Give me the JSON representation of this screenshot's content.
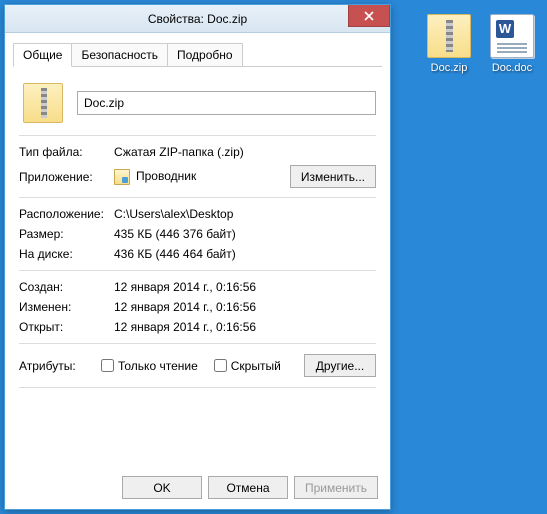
{
  "window": {
    "title": "Свойства: Doc.zip"
  },
  "tabs": {
    "general": "Общие",
    "security": "Безопасность",
    "details": "Подробно"
  },
  "file": {
    "name": "Doc.zip"
  },
  "labels": {
    "file_type": "Тип файла:",
    "application": "Приложение:",
    "location": "Расположение:",
    "size": "Размер:",
    "size_on_disk": "На диске:",
    "created": "Создан:",
    "modified": "Изменен:",
    "accessed": "Открыт:",
    "attributes": "Атрибуты:",
    "readonly": "Только чтение",
    "hidden": "Скрытый"
  },
  "values": {
    "file_type": "Сжатая ZIP-папка (.zip)",
    "application": "Проводник",
    "location": "C:\\Users\\alex\\Desktop",
    "size": "435 КБ (446 376 байт)",
    "size_on_disk": "436 КБ (446 464 байт)",
    "created": "12 января 2014 г., 0:16:56",
    "modified": "12 января 2014 г., 0:16:56",
    "accessed": "12 января 2014 г., 0:16:56"
  },
  "buttons": {
    "change": "Изменить...",
    "other": "Другие...",
    "ok": "OK",
    "cancel": "Отмена",
    "apply": "Применить"
  },
  "desktop": {
    "icon1": "Doc.zip",
    "icon2": "Doc.doc"
  }
}
